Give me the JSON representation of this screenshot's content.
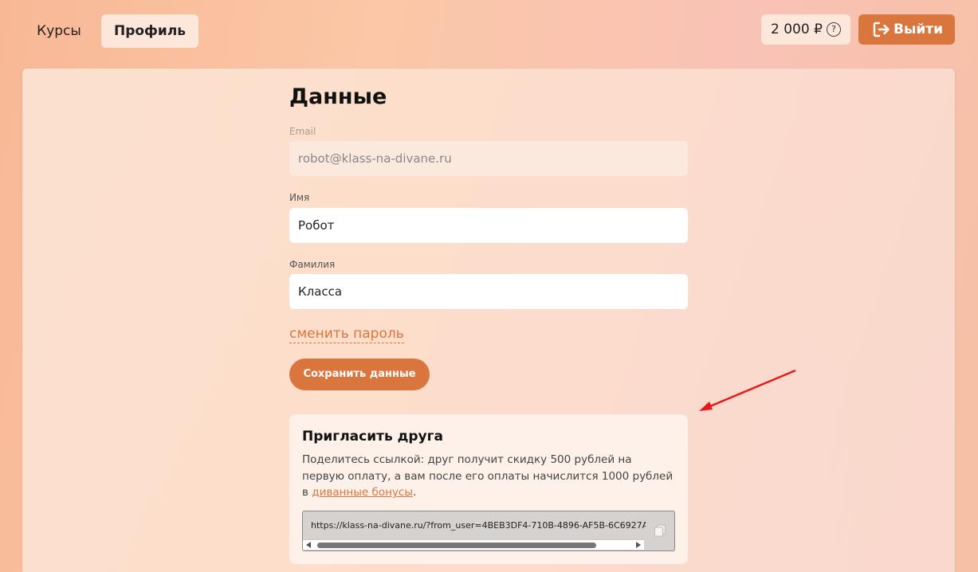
{
  "nav": {
    "courses": "Курсы",
    "profile": "Профиль",
    "balance": "2 000 ₽",
    "help": "?",
    "logout": "Выйти"
  },
  "profile": {
    "title": "Данные",
    "email_label": "Email",
    "email_value": "robot@klass-na-divane.ru",
    "name_label": "Имя",
    "name_value": "Робот",
    "surname_label": "Фамилия",
    "surname_value": "Класса",
    "change_password": "сменить пароль",
    "save_button": "Сохранить данные"
  },
  "invite": {
    "title": "Пригласить друга",
    "text": "Поделитесь ссылкой: друг получит скидку 500 рублей на первую оплату, а вам после его оплаты начислится 1000 рублей в ",
    "link_text": "диванные бонусы",
    "text_end": ".",
    "referral_link": "https://klass-na-divane.ru/?from_user=4BEB3DF4-710B-4896-AF5B-6C6927A"
  },
  "colors": {
    "accent": "#d9763e",
    "annotation_arrow": "#e8181c"
  },
  "icons": {
    "help": "question-circle-icon",
    "logout": "sign-out-icon",
    "copy": "copy-icon",
    "annotation": "red-arrow"
  }
}
